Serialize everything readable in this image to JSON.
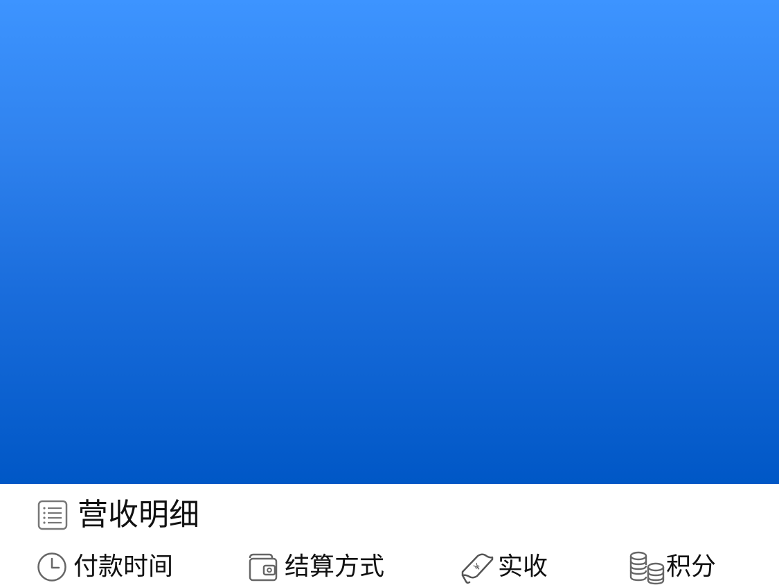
{
  "section": {
    "title": "营收明细",
    "title_icon": "list-icon"
  },
  "columns": [
    {
      "label": "付款时间",
      "icon": "clock-icon"
    },
    {
      "label": "结算方式",
      "icon": "wallet-icon"
    },
    {
      "label": "实收",
      "icon": "banknote-icon"
    },
    {
      "label": "积分",
      "icon": "coins-icon"
    }
  ],
  "colors": {
    "hero_top": "#3d94ff",
    "hero_bottom": "#0057c6",
    "icon_stroke": "#666666",
    "text": "#111111"
  }
}
